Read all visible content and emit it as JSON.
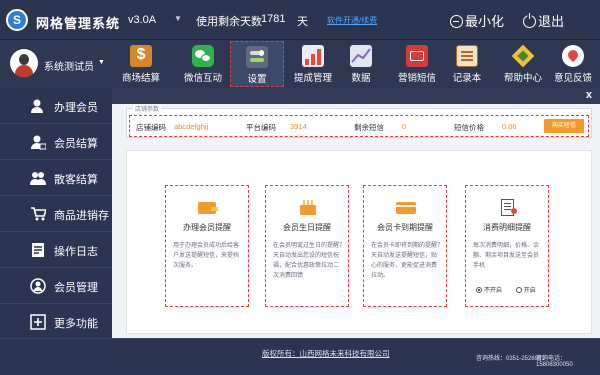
{
  "app": {
    "title": "网格管理系统",
    "logo_letter": "S",
    "version": "v3.0A"
  },
  "license": {
    "label": "使用剩余天数",
    "days": "1781",
    "unit": "天",
    "renew_link": "软件开通/续费"
  },
  "window": {
    "minimize": "最小化",
    "exit": "退出"
  },
  "user": {
    "name": "系统测试员"
  },
  "toolbar": [
    {
      "label": "商场结算",
      "icon": "dollar-icon"
    },
    {
      "label": "微信互动",
      "icon": "wechat-icon"
    },
    {
      "label": "设置",
      "icon": "settings-icon"
    },
    {
      "label": "提成管理",
      "icon": "commission-icon"
    },
    {
      "label": "数据",
      "icon": "chart-icon"
    },
    {
      "label": "营销短信",
      "icon": "sms-icon"
    },
    {
      "label": "记录本",
      "icon": "notebook-icon"
    },
    {
      "label": "帮助中心",
      "icon": "help-icon"
    },
    {
      "label": "意见反馈",
      "icon": "feedback-icon"
    }
  ],
  "sidebar": [
    {
      "label": "办理会员",
      "icon": "add-member-icon"
    },
    {
      "label": "会员结算",
      "icon": "member-checkout-icon"
    },
    {
      "label": "散客结算",
      "icon": "guest-checkout-icon"
    },
    {
      "label": "商品进销存",
      "icon": "cart-icon"
    },
    {
      "label": "操作日志",
      "icon": "log-icon"
    },
    {
      "label": "会员管理",
      "icon": "member-manage-icon"
    },
    {
      "label": "更多功能",
      "icon": "plus-icon"
    }
  ],
  "info": {
    "legend": "店铺参数",
    "store_code_label": "店铺编码",
    "store_code_value": "abcdefghij",
    "platform_code_label": "平台编码",
    "platform_code_value": "3914",
    "sms_left_label": "剩余短信",
    "sms_left_value": "0",
    "sms_price_label": "短信价格",
    "sms_price_value": "0.06",
    "buy_button": "购买短信"
  },
  "cards": [
    {
      "title": "办理会员提醒",
      "desc": "用于办理会员成功后给客户发送提醒短信，来提档次服务。"
    },
    {
      "title": "会员生日提醒",
      "desc": "在会员明诞过生日的提醒7天自动发出您设的短信祝福，配合优惠政策拉动二次消费回馈"
    },
    {
      "title": "会员卡到期提醒",
      "desc": "在会员卡即将到期的提醒7天自动发送提醒短信，贴心的服务，更能促进消费拉动。"
    },
    {
      "title": "消费明细提醒",
      "desc": "每次消费明细，价格、余额、剩余项目发送至会员手机",
      "opt_off": "不开启",
      "opt_on": "开启"
    }
  ],
  "footer": {
    "copyright": "版权所有：山西网格未来科技有限公司",
    "hotline1": "咨询热线：0351-2526981",
    "hotline2": "咨询电话：15808300050"
  },
  "colors": {
    "accent": "#e23b3b",
    "orange": "#f39a2b",
    "bg": "#2b3450",
    "link": "#4fa3ff"
  }
}
